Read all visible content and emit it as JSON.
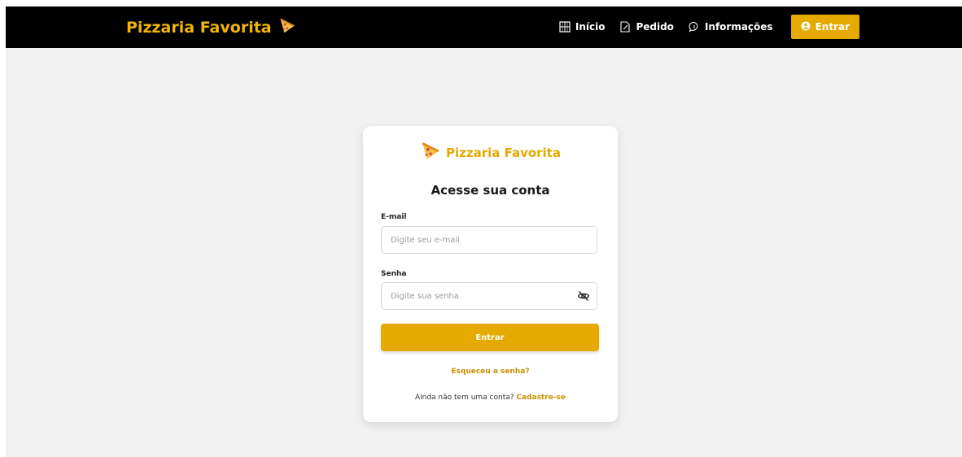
{
  "navbar": {
    "brand": "Pizzaria Favorita",
    "links": [
      {
        "label": "Início",
        "icon": "grid-icon"
      },
      {
        "label": "Pedido",
        "icon": "edit-icon"
      },
      {
        "label": "Informações",
        "icon": "chat-icon"
      }
    ],
    "enter_label": "Entrar",
    "enter_icon": "user-circle-icon"
  },
  "login": {
    "brand": "Pizzaria Favorita",
    "title": "Acesse sua conta",
    "email_label": "E-mail",
    "email_placeholder": "Digite seu e-mail",
    "email_value": "",
    "password_label": "Senha",
    "password_placeholder": "Digite sua senha",
    "password_value": "",
    "toggle_icon": "eye-off-icon",
    "submit_label": "Entrar",
    "forgot_label": "Esqueceu a senha?",
    "no_account_text": "Ainda não tem uma conta?",
    "signup_label": "Cadastre-se"
  },
  "colors": {
    "accent": "#e5a900",
    "brand_text": "#f2b705",
    "navbar_bg": "#000000",
    "page_bg": "#f2f2f2"
  }
}
